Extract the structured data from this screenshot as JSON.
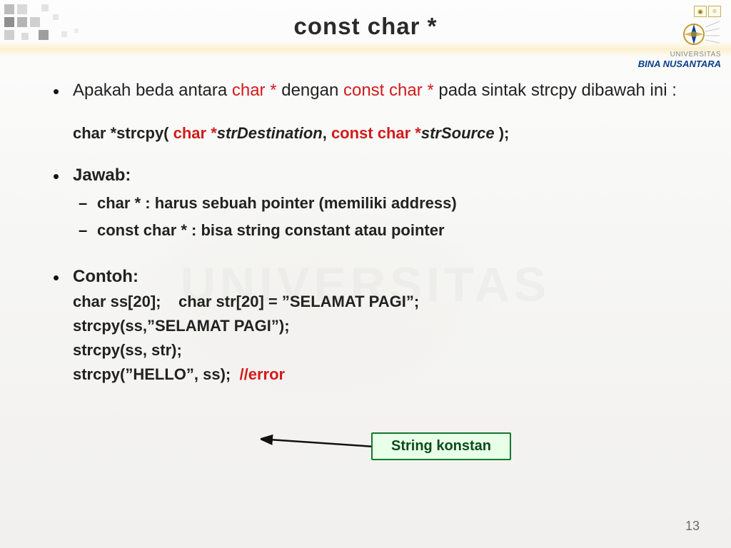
{
  "title": "const char *",
  "logo": {
    "line1": "UNIVERSITAS",
    "line2": "BINA NUSANTARA"
  },
  "q": {
    "p1a": "Apakah beda antara ",
    "p1b": "char * ",
    "p1c": "dengan ",
    "p1d": "const char * ",
    "p1e": "pada sintak strcpy dibawah ini :"
  },
  "func": {
    "a": "char *strcpy( ",
    "b": "char *",
    "c": "strDestination",
    "d": ", ",
    "e": "const char *",
    "f": "strSource",
    "g": " );"
  },
  "jawab": {
    "head": "Jawab:",
    "l1": "char * : harus sebuah pointer (memiliki address)",
    "l2": "const char * : bisa string constant atau pointer"
  },
  "contoh": {
    "head": "Contoh:",
    "l1": "char ss[20];    char str[20] = ”SELAMAT PAGI”;",
    "l2": "strcpy(ss,”SELAMAT PAGI”);",
    "l3": "strcpy(ss, str);",
    "l4a": "strcpy(”HELLO”, ss);  ",
    "l4b": "//error"
  },
  "callout": "String konstan",
  "page": "13",
  "watermark": "UNIVERSITAS"
}
